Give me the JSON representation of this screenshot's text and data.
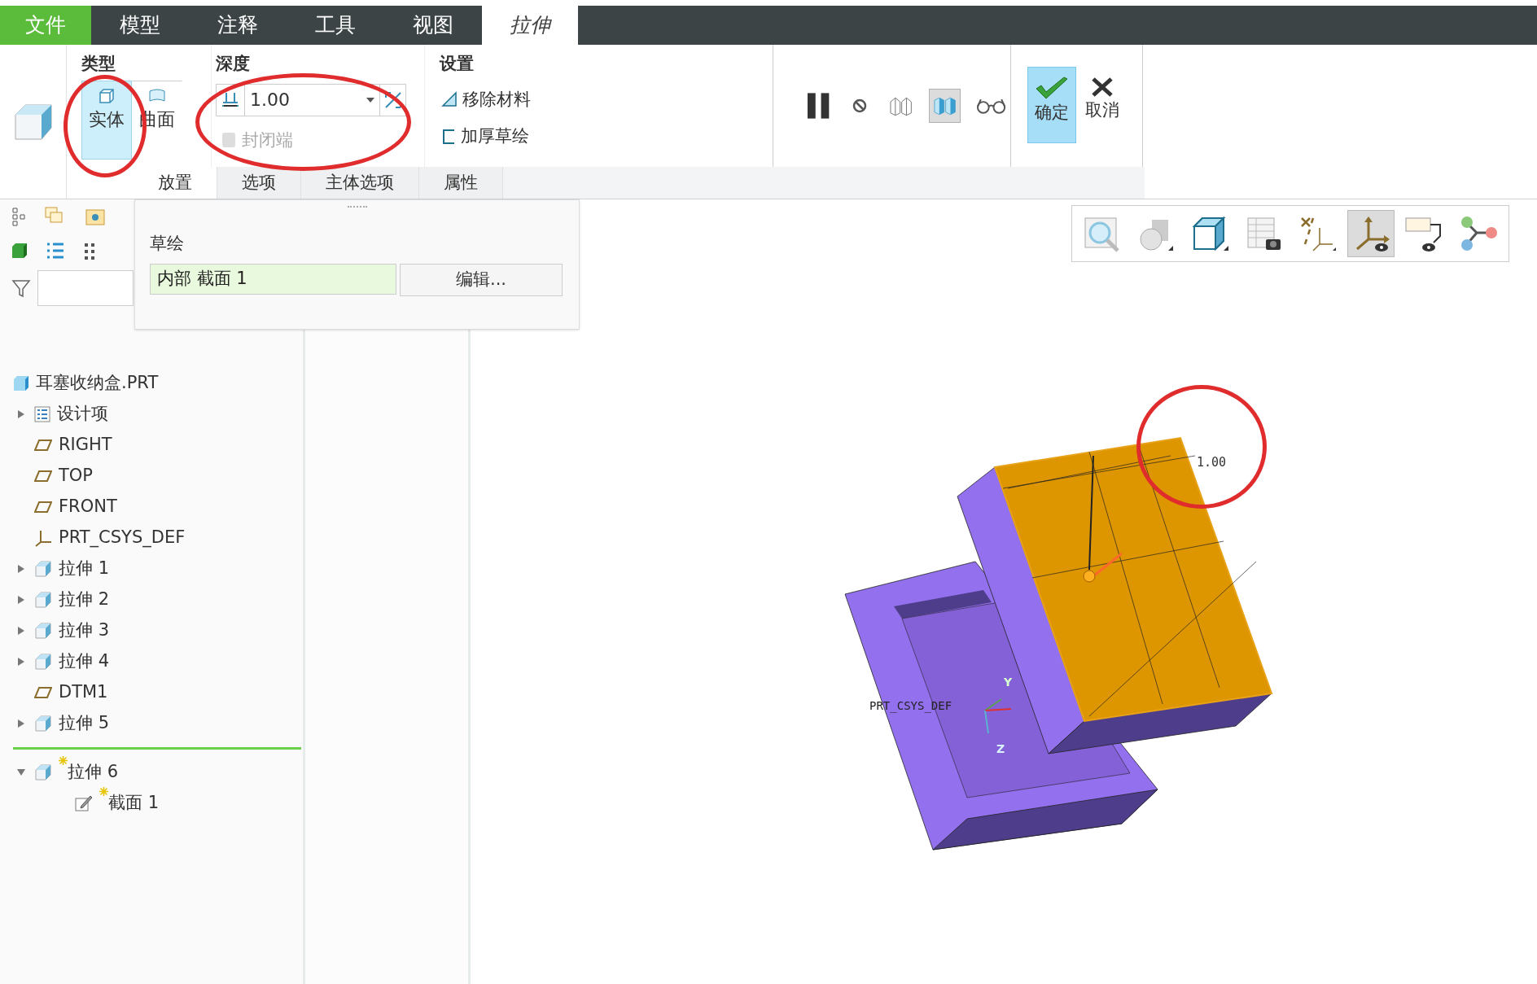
{
  "menu_tabs": [
    {
      "label": "文件",
      "kind": "file",
      "selected": false
    },
    {
      "label": "模型",
      "kind": "tab",
      "selected": false
    },
    {
      "label": "注释",
      "kind": "tab",
      "selected": false
    },
    {
      "label": "工具",
      "kind": "tab",
      "selected": false
    },
    {
      "label": "视图",
      "kind": "tab",
      "selected": false
    },
    {
      "label": "拉伸",
      "kind": "tab",
      "selected": true
    }
  ],
  "ribbon": {
    "type_group": {
      "title": "类型",
      "options": [
        {
          "label": "实体",
          "kind": "solid",
          "selected": true
        },
        {
          "label": "曲面",
          "kind": "surface",
          "selected": false
        }
      ]
    },
    "depth_group": {
      "title": "深度",
      "value": "1.00",
      "capped_ends": {
        "label": "封闭端",
        "disabled": true
      }
    },
    "settings_group": {
      "title": "设置",
      "options": [
        {
          "label": "移除材料",
          "kind": "remove",
          "checked": false
        },
        {
          "label": "加厚草绘",
          "kind": "thicken",
          "checked": false
        }
      ]
    },
    "preview_tools": [
      {
        "kind": "pause",
        "selected": false
      },
      {
        "kind": "no-preview",
        "selected": false
      },
      {
        "kind": "wireframe",
        "selected": false
      },
      {
        "kind": "verify",
        "selected": true
      },
      {
        "kind": "glasses",
        "selected": false
      }
    ],
    "ok": "确定",
    "cancel": "取消"
  },
  "sub_tabs": [
    {
      "label": "放置",
      "selected": true
    },
    {
      "label": "选项",
      "selected": false
    },
    {
      "label": "主体选项",
      "selected": false
    },
    {
      "label": "属性",
      "selected": false
    }
  ],
  "placement_panel": {
    "title": "草绘",
    "sketch": "内部 截面 1",
    "edit_button": "编辑..."
  },
  "model_tree": {
    "root": "耳塞收纳盒.PRT",
    "items": [
      {
        "label": "设计项",
        "kind": "design-items",
        "new": false,
        "expanded": false
      },
      {
        "label": "RIGHT",
        "kind": "plane",
        "new": false
      },
      {
        "label": "TOP",
        "kind": "plane",
        "new": false
      },
      {
        "label": "FRONT",
        "kind": "plane",
        "new": false
      },
      {
        "label": "PRT_CSYS_DEF",
        "kind": "csys",
        "new": false
      },
      {
        "label": "拉伸 1",
        "kind": "extrude",
        "new": false,
        "expanded": false
      },
      {
        "label": "拉伸 2",
        "kind": "extrude",
        "new": false,
        "expanded": false
      },
      {
        "label": "拉伸 3",
        "kind": "extrude",
        "new": false,
        "expanded": false
      },
      {
        "label": "拉伸 4",
        "kind": "extrude",
        "new": false,
        "expanded": false
      },
      {
        "label": "DTM1",
        "kind": "plane",
        "new": false
      },
      {
        "label": "拉伸 5",
        "kind": "extrude",
        "new": false,
        "expanded": false
      },
      {
        "kind": "insert-marker"
      },
      {
        "label": "拉伸 6",
        "kind": "extrude",
        "new": true,
        "expanded": true,
        "children": [
          {
            "label": "截面 1",
            "kind": "sketch",
            "new": true
          }
        ]
      }
    ]
  },
  "viewport": {
    "dimension": "1.00",
    "csys_label": "PRT_CSYS_DEF",
    "axis_labels": [
      "Y",
      "Z"
    ]
  },
  "view_toolbar": [
    {
      "kind": "zoom",
      "selected": false
    },
    {
      "kind": "shading",
      "selected": false
    },
    {
      "kind": "cube",
      "selected": false
    },
    {
      "kind": "table-camera",
      "selected": false
    },
    {
      "kind": "datum",
      "selected": false
    },
    {
      "kind": "csys-eye",
      "selected": true
    },
    {
      "kind": "note-eye",
      "selected": false
    },
    {
      "kind": "nodes",
      "selected": false
    }
  ]
}
